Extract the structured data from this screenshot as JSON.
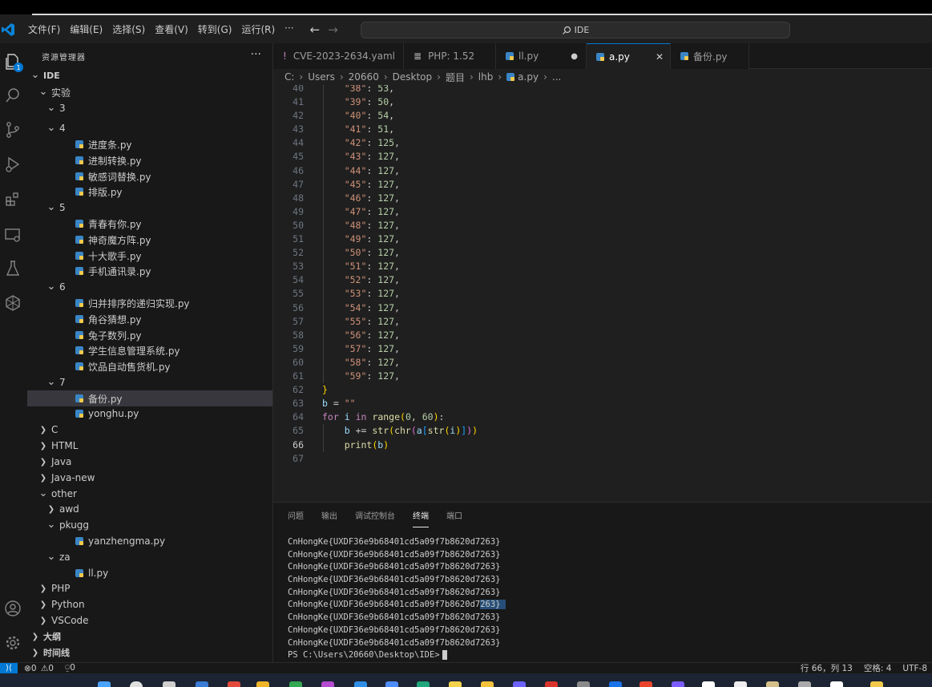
{
  "menu": [
    "文件(F)",
    "编辑(E)",
    "选择(S)",
    "查看(V)",
    "转到(G)",
    "运行(R)",
    "···"
  ],
  "search": {
    "text": "IDE"
  },
  "activity": {
    "badge": "1"
  },
  "explorer": {
    "title": "资源管理器",
    "more": "···",
    "rows": [
      {
        "label": "IDE",
        "depth": 0,
        "type": "folder-open",
        "bold": true
      },
      {
        "label": "实验",
        "depth": 1,
        "type": "folder-open"
      },
      {
        "label": "3",
        "depth": 2,
        "type": "folder-open"
      },
      {
        "label": "4",
        "depth": 2,
        "type": "folder-open"
      },
      {
        "label": "进度条.py",
        "depth": 3,
        "type": "py"
      },
      {
        "label": "进制转换.py",
        "depth": 3,
        "type": "py"
      },
      {
        "label": "敏感词替换.py",
        "depth": 3,
        "type": "py"
      },
      {
        "label": "排版.py",
        "depth": 3,
        "type": "py"
      },
      {
        "label": "5",
        "depth": 2,
        "type": "folder-open"
      },
      {
        "label": "青春有你.py",
        "depth": 3,
        "type": "py"
      },
      {
        "label": "神奇魔方阵.py",
        "depth": 3,
        "type": "py"
      },
      {
        "label": "十大歌手.py",
        "depth": 3,
        "type": "py"
      },
      {
        "label": "手机通讯录.py",
        "depth": 3,
        "type": "py"
      },
      {
        "label": "6",
        "depth": 2,
        "type": "folder-open"
      },
      {
        "label": "归并排序的递归实现.py",
        "depth": 3,
        "type": "py"
      },
      {
        "label": "角谷猜想.py",
        "depth": 3,
        "type": "py"
      },
      {
        "label": "兔子数列.py",
        "depth": 3,
        "type": "py"
      },
      {
        "label": "学生信息管理系统.py",
        "depth": 3,
        "type": "py"
      },
      {
        "label": "饮品自动售货机.py",
        "depth": 3,
        "type": "py"
      },
      {
        "label": "7",
        "depth": 2,
        "type": "folder-open"
      },
      {
        "label": "备份.py",
        "depth": 3,
        "type": "py",
        "selected": true
      },
      {
        "label": "yonghu.py",
        "depth": 3,
        "type": "py"
      },
      {
        "label": "C",
        "depth": 1,
        "type": "folder"
      },
      {
        "label": "HTML",
        "depth": 1,
        "type": "folder"
      },
      {
        "label": "Java",
        "depth": 1,
        "type": "folder"
      },
      {
        "label": "Java-new",
        "depth": 1,
        "type": "folder"
      },
      {
        "label": "other",
        "depth": 1,
        "type": "folder-open"
      },
      {
        "label": "awd",
        "depth": 2,
        "type": "folder"
      },
      {
        "label": "pkugg",
        "depth": 2,
        "type": "folder-open"
      },
      {
        "label": "yanzhengma.py",
        "depth": 3,
        "type": "py"
      },
      {
        "label": "za",
        "depth": 2,
        "type": "folder-open"
      },
      {
        "label": "ll.py",
        "depth": 3,
        "type": "py"
      },
      {
        "label": "PHP",
        "depth": 1,
        "type": "folder"
      },
      {
        "label": "Python",
        "depth": 1,
        "type": "folder"
      },
      {
        "label": "VSCode",
        "depth": 1,
        "type": "folder"
      }
    ],
    "outline": "大纲",
    "timeline": "时间线"
  },
  "tabs": [
    {
      "label": "CVE-2023-2634.yaml",
      "icon": "!",
      "icon_color": "#c586c0"
    },
    {
      "label": "PHP: 1.52",
      "icon": "≣",
      "icon_color": "#cccccc"
    },
    {
      "label": "ll.py",
      "icon": "py",
      "icon_color": "#3a85c5",
      "dirty": "●"
    },
    {
      "label": "a.py",
      "icon": "py",
      "icon_color": "#3a85c5",
      "active": true,
      "close": "✕"
    },
    {
      "label": "备份.py",
      "icon": "py",
      "icon_color": "#3a85c5"
    }
  ],
  "breadcrumb": [
    "C:",
    "Users",
    "20660",
    "Desktop",
    "题目",
    "lhb",
    "a.py",
    "..."
  ],
  "code": {
    "dict_entries": [
      [
        "41",
        "39",
        "50"
      ],
      [
        "42",
        "40",
        "54"
      ],
      [
        "43",
        "41",
        "51"
      ],
      [
        "44",
        "42",
        "125"
      ],
      [
        "45",
        "43",
        "127"
      ],
      [
        "46",
        "44",
        "127"
      ],
      [
        "47",
        "45",
        "127"
      ],
      [
        "48",
        "46",
        "127"
      ],
      [
        "49",
        "47",
        "127"
      ],
      [
        "50",
        "48",
        "127"
      ],
      [
        "51",
        "49",
        "127"
      ],
      [
        "52",
        "50",
        "127"
      ],
      [
        "53",
        "51",
        "127"
      ],
      [
        "54",
        "52",
        "127"
      ],
      [
        "55",
        "53",
        "127"
      ],
      [
        "56",
        "54",
        "127"
      ],
      [
        "57",
        "55",
        "127"
      ],
      [
        "58",
        "56",
        "127"
      ],
      [
        "59",
        "57",
        "127"
      ],
      [
        "60",
        "58",
        "127"
      ],
      [
        "61",
        "59",
        "127"
      ]
    ],
    "tail": {
      "l62": "62",
      "l63": "63",
      "l64": "64",
      "l65": "65",
      "l66": "66",
      "l67": "67",
      "close_brace": "}",
      "b_var": "b",
      "eq": " = ",
      "empty_str": "\"\"",
      "for_kw": "for",
      "i_var": "i",
      "in_kw": "in",
      "range_fn": "range",
      "range_args": "0, 60",
      "plus_eq": " += ",
      "str_fn": "str",
      "chr_fn": "chr",
      "a_var": "a",
      "print_fn": "print"
    },
    "top_partial": "40"
  },
  "panel": {
    "tabs": [
      "问题",
      "输出",
      "调试控制台",
      "终端",
      "端口"
    ],
    "active_tab": "终端",
    "lines": [
      "CnHongKe{UXDF36e9b68401cd5a09f7b8620d7263}",
      "CnHongKe{UXDF36e9b68401cd5a09f7b8620d7263}",
      "CnHongKe{UXDF36e9b68401cd5a09f7b8620d7263}",
      "CnHongKe{UXDF36e9b68401cd5a09f7b8620d7263}",
      "CnHongKe{UXDF36e9b68401cd5a09f7b8620d7263}",
      "CnHongKe{UXDF36e9b68401cd5a09f7b8620d7263}",
      "CnHongKe{UXDF36e9b68401cd5a09f7b8620d7263}",
      "CnHongKe{UXDF36e9b68401cd5a09f7b8620d7263}",
      "CnHongKe{UXDF36e9b68401cd5a09f7b8620d7263}"
    ],
    "prompt": "PS C:\\Users\\20660\\Desktop\\IDE>"
  },
  "status": {
    "errors": "0",
    "warnings": "0",
    "ports": "0",
    "position": "行 66，列 13",
    "spaces": "空格: 4",
    "encoding": "UTF-8"
  }
}
